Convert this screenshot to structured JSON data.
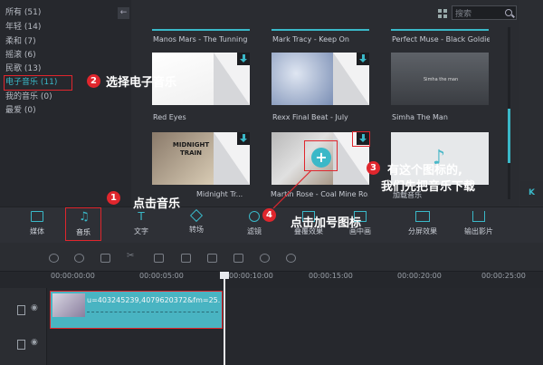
{
  "sidebar": {
    "collapse_label": "←",
    "categories": [
      {
        "label": "所有 (51)"
      },
      {
        "label": "年轻 (14)"
      },
      {
        "label": "柔和 (7)"
      },
      {
        "label": "摇滚 (6)"
      },
      {
        "label": "民歌 (13)"
      },
      {
        "label": "电子音乐 (11)",
        "active": true
      },
      {
        "label": "我的音乐 (0)"
      },
      {
        "label": "最爱 (0)"
      }
    ]
  },
  "search": {
    "placeholder": "搜索"
  },
  "tracks_top": [
    {
      "title": "Manos Mars - The Tunning"
    },
    {
      "title": "Mark Tracy - Keep On"
    },
    {
      "title": "Perfect Muse - Black Goldie"
    }
  ],
  "tracks_mid": [
    {
      "title": "Red Eyes"
    },
    {
      "title": "Rexx Final Beat - July"
    },
    {
      "title": "Simha The Man",
      "art_text": "Simha the man"
    }
  ],
  "tracks_bottom": [
    {
      "title": "Midnight Tr...",
      "art_text": "MIDNIGHT TRAIN"
    },
    {
      "title": "Martin Rose - Coal Mine Ro..."
    },
    {
      "title": "加载音乐"
    }
  ],
  "right_tab": "K",
  "toolbar": [
    {
      "label": "媒体",
      "icon": "folder-icon"
    },
    {
      "label": "音乐",
      "icon": "music-icon",
      "active": true
    },
    {
      "label": "文字",
      "icon": "text-icon"
    },
    {
      "label": "转场",
      "icon": "transition-icon"
    },
    {
      "label": "滤镜",
      "icon": "filter-icon"
    },
    {
      "label": "叠覆效果",
      "icon": "overlay-icon"
    },
    {
      "label": "画中画",
      "icon": "pip-icon"
    },
    {
      "label": "分屏效果",
      "icon": "split-screen-icon"
    },
    {
      "label": "输出影片",
      "icon": "export-icon"
    }
  ],
  "ruler": [
    "00:00:00:00",
    "00:00:05:00",
    "00:00:10:00",
    "00:00:15:00",
    "00:00:20:00",
    "00:00:25:00"
  ],
  "clip": {
    "name": "u=403245239,4079620372&fm=25..."
  },
  "annotations": {
    "step1": {
      "num": "1",
      "text": "点击音乐"
    },
    "step2": {
      "num": "2",
      "text": "选择电子音乐"
    },
    "step3": {
      "num": "3",
      "text_line1": "有这个图标的,",
      "text_line2": "我们先把音乐下载"
    },
    "step4": {
      "num": "4",
      "text": "点击加号图标"
    }
  },
  "colors": {
    "accent": "#3ab8c8",
    "annotation": "#e0262d"
  }
}
